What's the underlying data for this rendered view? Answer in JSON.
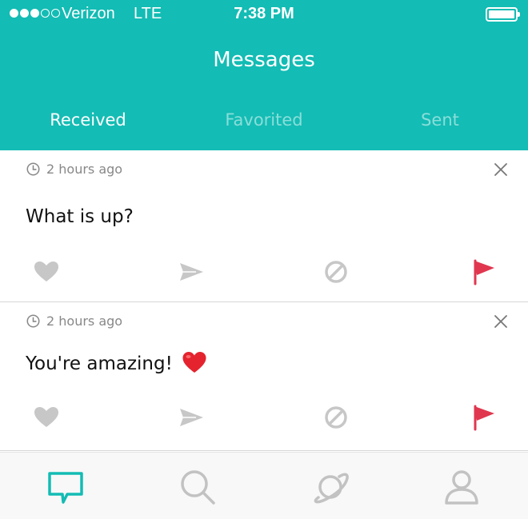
{
  "status_bar": {
    "carrier": "Verizon",
    "network": "LTE",
    "time": "7:38 PM",
    "signal_bars": 3,
    "signal_total": 5,
    "battery_level": 1.0
  },
  "header": {
    "title": "Messages",
    "tabs": [
      {
        "label": "Received",
        "active": true
      },
      {
        "label": "Favorited",
        "active": false
      },
      {
        "label": "Sent",
        "active": false
      }
    ]
  },
  "messages": [
    {
      "time": "2 hours ago",
      "text": "What is up?",
      "emoji": null
    },
    {
      "time": "2 hours ago",
      "text": "You're amazing!",
      "emoji": "red-heart"
    }
  ],
  "actions": [
    "heart-icon",
    "send-icon",
    "block-icon",
    "flag-icon"
  ],
  "tabbar": [
    "messages-icon",
    "search-icon",
    "planet-icon",
    "profile-icon"
  ],
  "colors": {
    "accent": "#13bcb4",
    "flag": "#e0374f",
    "icon_gray": "#c7c7c7",
    "text_gray": "#888888"
  }
}
